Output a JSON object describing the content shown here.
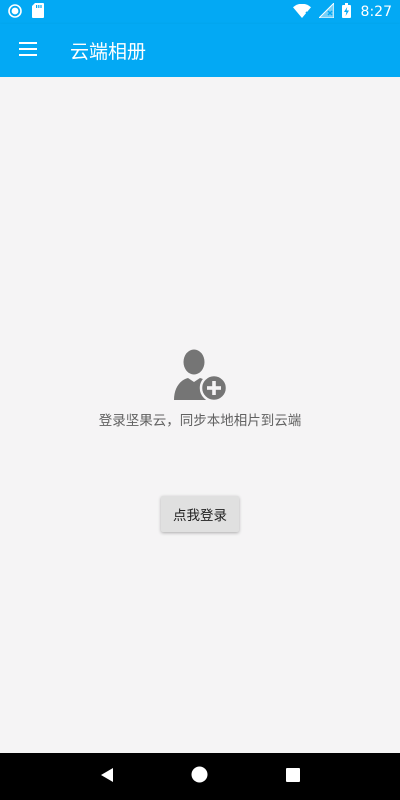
{
  "status_bar": {
    "time": "8:27",
    "left_icons": [
      "notification-circle-icon",
      "sd-card-icon"
    ],
    "right_icons": [
      "wifi-icon",
      "cellular-no-signal-icon",
      "battery-charging-icon"
    ]
  },
  "app_bar": {
    "title": "云端相册",
    "menu_icon": "hamburger-menu-icon"
  },
  "empty_state": {
    "icon": "add-user-icon",
    "message": "登录坚果云，同步本地相片到云端",
    "button_label": "点我登录"
  },
  "nav_bar": {
    "buttons": [
      "back-icon",
      "home-icon",
      "recents-icon"
    ]
  },
  "colors": {
    "primary": "#03a9f4",
    "background": "#f5f4f5",
    "icon_gray": "#757575",
    "button_bg": "#e0e0e0"
  }
}
